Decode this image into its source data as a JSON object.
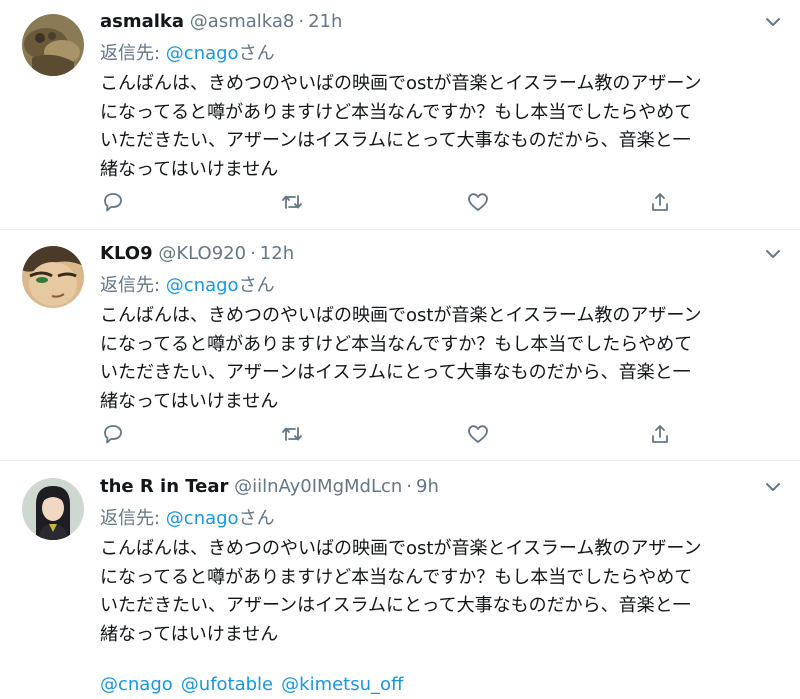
{
  "colors": {
    "accent": "#1b95e0",
    "muted": "#657786",
    "text": "#14171a",
    "divider": "#e6ecf0"
  },
  "icons": {
    "reply": "reply-icon",
    "retweet": "retweet-icon",
    "like": "heart-icon",
    "share": "share-icon",
    "more": "chevron-down-icon"
  },
  "tweets": [
    {
      "name": "asmalka",
      "handle": "@asmalka8",
      "dot": "·",
      "time": "21h",
      "reply_prefix": "返信先: ",
      "reply_mention": "@cnago",
      "reply_suffix": "さん",
      "lines": [
        "こんばんは、きめつのやいばの映画でostが音楽とイスラーム教のアザーン",
        "になってると噂がありますけど本当なんですか？もし本当でしたらやめて",
        "いただきたい、アザーンはイスラムにとって大事なものだから、音楽と一",
        "緒なってはいけません"
      ]
    },
    {
      "name": "KLO9",
      "handle": "@KLO920",
      "dot": "·",
      "time": "12h",
      "reply_prefix": "返信先: ",
      "reply_mention": "@cnago",
      "reply_suffix": "さん",
      "lines": [
        "こんばんは、きめつのやいばの映画でostが音楽とイスラーム教のアザーン",
        "になってると噂がありますけど本当なんですか？もし本当でしたらやめて",
        "いただきたい、アザーンはイスラムにとって大事なものだから、音楽と一",
        "緒なってはいけません"
      ]
    },
    {
      "name": "the R in Tear",
      "handle": "@iilnAy0IMgMdLcn",
      "dot": "·",
      "time": "9h",
      "reply_prefix": "返信先: ",
      "reply_mention": "@cnago",
      "reply_suffix": "さん",
      "lines": [
        "こんばんは、きめつのやいばの映画でostが音楽とイスラーム教のアザーン",
        "になってると噂がありますけど本当なんですか？もし本当でしたらやめて",
        "いただきたい、アザーンはイスラムにとって大事なものだから、音楽と一",
        "緒なってはいけません"
      ],
      "mentions": [
        "@cnago",
        "@ufotable",
        "@kimetsu_off"
      ]
    }
  ]
}
